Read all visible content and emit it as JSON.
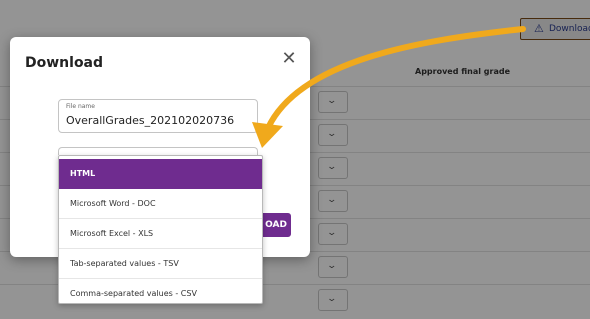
{
  "background": {
    "column_header": "Approved final grade",
    "download_button_label": "Download"
  },
  "modal": {
    "title": "Download",
    "close_glyph": "✕",
    "file_name_label": "File name",
    "file_name_value": "OverallGrades_202102020736",
    "download_button_label": "OAD"
  },
  "format_dropdown": {
    "selected": "HTML",
    "options": [
      "HTML",
      "Microsoft Word - DOC",
      "Microsoft Excel - XLS",
      "Tab-separated values - TSV",
      "Comma-separated values - CSV"
    ]
  },
  "icons": {
    "download_icon": "warning-triangle-icon",
    "close_icon": "close-icon",
    "chevron": "chevron-down-icon"
  },
  "colors": {
    "accent": "#6f2c8f",
    "annotation_arrow": "#f0a91c"
  }
}
